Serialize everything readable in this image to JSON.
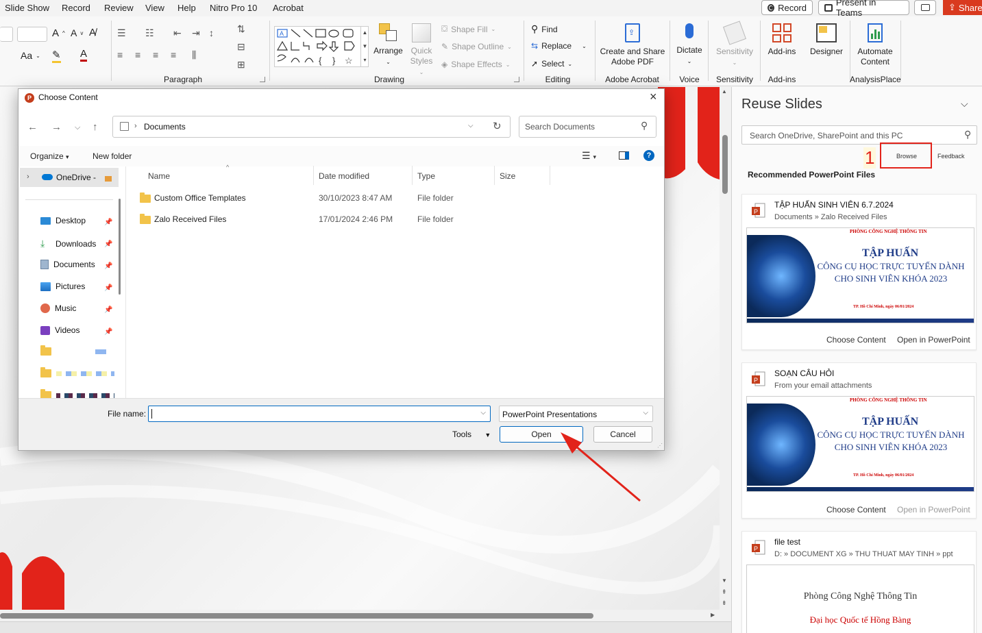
{
  "menu": {
    "items": [
      "Slide Show",
      "Record",
      "Review",
      "View",
      "Help",
      "Nitro Pro 10",
      "Acrobat"
    ],
    "record_button": "Record",
    "present_button": "Present in Teams",
    "share_button": "Share"
  },
  "ribbon": {
    "groups": {
      "paragraph": "Paragraph",
      "drawing": "Drawing",
      "editing": "Editing",
      "adobe": "Adobe Acrobat",
      "voice": "Voice",
      "sensitivity": "Sensitivity",
      "addins": "Add-ins",
      "analysis": "AnalysisPlace"
    },
    "font_aa": "Aa",
    "arrange": "Arrange",
    "quick_styles_1": "Quick",
    "quick_styles_2": "Styles",
    "shape_fill": "Shape Fill",
    "shape_outline": "Shape Outline",
    "shape_effects": "Shape Effects",
    "find": "Find",
    "replace": "Replace",
    "select": "Select",
    "create_share_1": "Create and Share",
    "create_share_2": "Adobe PDF",
    "dictate": "Dictate",
    "sensitivity_btn": "Sensitivity",
    "addins_btn": "Add-ins",
    "designer": "Designer",
    "automate_1": "Automate",
    "automate_2": "Content"
  },
  "reuse": {
    "title": "Reuse Slides",
    "search_placeholder": "Search OneDrive, SharePoint and this PC",
    "annotation_number": "1",
    "browse": "Browse",
    "feedback": "Feedback",
    "recommended": "Recommended PowerPoint Files",
    "cards": [
      {
        "title": "TẬP HUẤN SINH VIÊN 6.7.2024",
        "subtitle": "Documents » Zalo Received Files",
        "thumb_header": "PHÒNG CÔNG NGHỆ THÔNG TIN",
        "thumb_title": "TẬP HUẤN",
        "thumb_line1": "CÔNG CỤ HỌC TRỰC TUYẾN DÀNH",
        "thumb_line2": "CHO SINH VIÊN KHÓA 2023",
        "thumb_footer": "TP. Hồ Chí Minh, ngày 06/01/2024",
        "choose": "Choose Content",
        "open": "Open in PowerPoint"
      },
      {
        "title": "SOẠN CÂU HỎI",
        "subtitle": "From your email attachments",
        "thumb_header": "PHÒNG CÔNG NGHỆ THÔNG TIN",
        "thumb_title": "TẬP HUẤN",
        "thumb_line1": "CÔNG CỤ HỌC TRỰC TUYẾN DÀNH",
        "thumb_line2": "CHO SINH VIÊN KHÓA 2023",
        "thumb_footer": "TP. Hồ Chí Minh, ngày 06/01/2024",
        "choose": "Choose Content",
        "open": "Open in PowerPoint"
      },
      {
        "title": "file test",
        "subtitle": "D: » DOCUMENT XG » THU THUAT MAY TINH » ppt",
        "thumb_line1": "Phòng Công Nghệ Thông Tin",
        "thumb_line2": "Đại học Quốc tế Hồng Bàng"
      }
    ]
  },
  "dialog": {
    "title": "Choose Content",
    "path_folder": "Documents",
    "search_placeholder": "Search Documents",
    "organize": "Organize",
    "new_folder": "New folder",
    "sidebar": {
      "onedrive": "OneDrive -",
      "items": [
        "Desktop",
        "Downloads",
        "Documents",
        "Pictures",
        "Music",
        "Videos"
      ]
    },
    "columns": {
      "name": "Name",
      "date": "Date modified",
      "type": "Type",
      "size": "Size"
    },
    "files": [
      {
        "name": "Custom Office Templates",
        "date": "30/10/2023 8:47 AM",
        "type": "File folder"
      },
      {
        "name": "Zalo Received Files",
        "date": "17/01/2024 2:46 PM",
        "type": "File folder"
      }
    ],
    "filename_label": "File name:",
    "filename_value": "",
    "filter": "PowerPoint Presentations",
    "tools": "Tools",
    "open": "Open",
    "cancel": "Cancel"
  },
  "colors": {
    "accent_red": "#e2231a",
    "share_bg": "#d93a1f",
    "dialog_blue": "#0067c0",
    "folder_yellow": "#f2c34a"
  }
}
